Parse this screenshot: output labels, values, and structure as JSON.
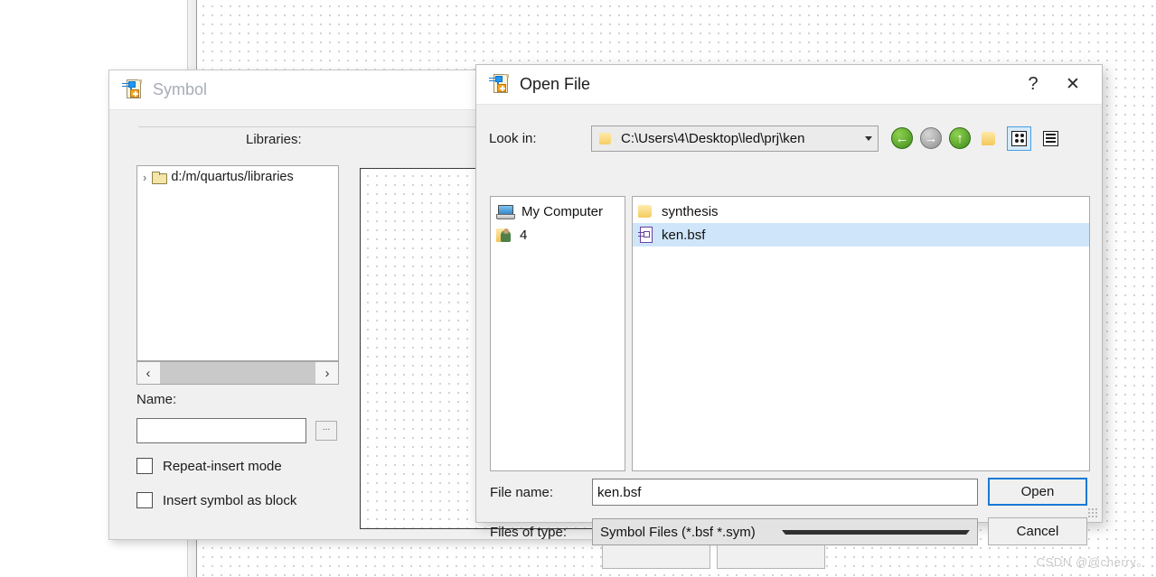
{
  "background": {
    "watermark": "CSDN @@cherry。"
  },
  "symbol_dialog": {
    "title": "Symbol",
    "icon": "symbol-file-icon",
    "libraries_label": "Libraries:",
    "library_tree": [
      {
        "label": "d:/m/quartus/libraries",
        "icon": "folder-icon",
        "expander": "›"
      }
    ],
    "scroll_left_arrow": "‹",
    "scroll_right_arrow": "›",
    "name_label": "Name:",
    "name_value": "",
    "browse_label": "...",
    "checkboxes": [
      {
        "label": "Repeat-insert mode",
        "checked": false
      },
      {
        "label": "Insert symbol as block",
        "checked": false
      }
    ]
  },
  "open_file_dialog": {
    "title": "Open File",
    "icon": "symbol-file-icon",
    "help_label": "?",
    "close_label": "✕",
    "lookin_label": "Look in:",
    "lookin_value": "C:\\Users\\4\\Desktop\\led\\prj\\ken",
    "nav": {
      "back": "back-arrow-icon",
      "forward": "forward-arrow-icon",
      "up": "up-arrow-icon",
      "new_folder": "new-folder-icon",
      "list_view": "list-view-icon",
      "detail_view": "detail-view-icon"
    },
    "sidebar_items": [
      {
        "label": "My Computer",
        "icon": "computer-icon"
      },
      {
        "label": "4",
        "icon": "user-folder-icon"
      }
    ],
    "files": [
      {
        "name": "synthesis",
        "icon": "folder-icon",
        "selected": false
      },
      {
        "name": "ken.bsf",
        "icon": "bsf-file-icon",
        "selected": true
      }
    ],
    "filename_label": "File name:",
    "filename_value": "ken.bsf",
    "filetype_label": "Files of type:",
    "filetype_value": "Symbol Files (*.bsf *.sym)",
    "open_label": "Open",
    "cancel_label": "Cancel"
  },
  "colors": {
    "selection": "#cfe6fa",
    "accent": "#1779d6",
    "dialog_bg": "#f0f0f0"
  }
}
